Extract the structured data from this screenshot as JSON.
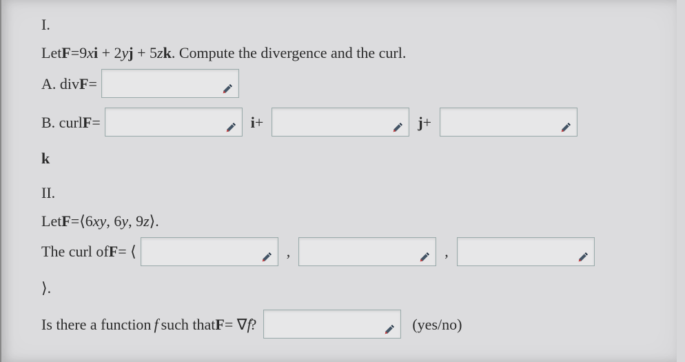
{
  "partI": {
    "heading": "I.",
    "let_prefix": "Let ",
    "F": "F",
    "eq": " = ",
    "expr": "9xi + 2yj + 5zk",
    "compute_text": ". Compute the divergence and the curl.",
    "A_prefix": "A. div ",
    "A_eq": " =",
    "B_prefix": "B. curl ",
    "B_eq": " =",
    "i_plus": "i+",
    "j_plus": "j+",
    "k_label": "k"
  },
  "partII": {
    "heading": "II.",
    "let_prefix": "Let ",
    "F": "F",
    "eq": " = ",
    "vector": "⟨6xy, 6y, 9z⟩",
    "dot": ".",
    "curl_prefix": "The curl of ",
    "curl_eq": " = ⟨",
    "comma": ",",
    "close": "⟩.",
    "question_prefix": "Is there a function ",
    "f": "f",
    "question_mid": " such that ",
    "grad": " = ∇",
    "question_q": "?",
    "yesno": "(yes/no)"
  },
  "icons": {
    "edit": "edit-icon"
  }
}
